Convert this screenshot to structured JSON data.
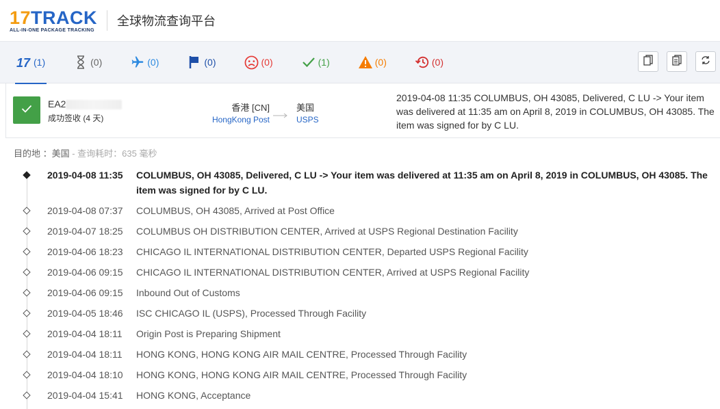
{
  "header": {
    "logo_17": "17",
    "logo_track": "TRACK",
    "logo_tagline": "ALL-IN-ONE PACKAGE TRACKING",
    "title": "全球物流查询平台"
  },
  "filters": [
    {
      "icon": "17track-logo-icon",
      "count": "(1)",
      "color": "#2565c6"
    },
    {
      "icon": "hourglass-icon",
      "count": "(0)",
      "color": "#666666"
    },
    {
      "icon": "airplane-icon",
      "count": "(0)",
      "color": "#2d8ae0"
    },
    {
      "icon": "flag-icon",
      "count": "(0)",
      "color": "#1e4fa8"
    },
    {
      "icon": "sad-face-icon",
      "count": "(0)",
      "color": "#e53935"
    },
    {
      "icon": "checkmark-icon",
      "count": "(1)",
      "color": "#43a047"
    },
    {
      "icon": "warning-icon",
      "count": "(0)",
      "color": "#f57c00"
    },
    {
      "icon": "history-icon",
      "count": "(0)",
      "color": "#d32f2f"
    }
  ],
  "toolbar_buttons": [
    "copy-icon",
    "copy-all-icon",
    "refresh-icon"
  ],
  "summary": {
    "tracking_prefix": "EA2",
    "status": "成功签收 (4 天)",
    "origin_country": "香港 [CN]",
    "origin_carrier": "HongKong Post",
    "dest_country": "美国",
    "dest_carrier": "USPS",
    "latest_event": "2019-04-08 11:35   COLUMBUS, OH 43085, Delivered, C LU -> Your item was delivered at 11:35 am on April 8, 2019 in COLUMBUS, OH 43085. The item was signed for by C LU."
  },
  "destination_line": {
    "label": "目的地 ：美国",
    "query_time": " - 查询耗时：635 毫秒"
  },
  "events": [
    {
      "time": "2019-04-08 11:35",
      "desc": "COLUMBUS, OH 43085, Delivered, C LU -> Your item was delivered at 11:35 am on April 8, 2019 in COLUMBUS, OH 43085. The item was signed for by C LU."
    },
    {
      "time": "2019-04-08 07:37",
      "desc": "COLUMBUS, OH 43085, Arrived at Post Office"
    },
    {
      "time": "2019-04-07 18:25",
      "desc": "COLUMBUS OH DISTRIBUTION CENTER, Arrived at USPS Regional Destination Facility"
    },
    {
      "time": "2019-04-06 18:23",
      "desc": "CHICAGO IL INTERNATIONAL DISTRIBUTION CENTER, Departed USPS Regional Facility"
    },
    {
      "time": "2019-04-06 09:15",
      "desc": "CHICAGO IL INTERNATIONAL DISTRIBUTION CENTER, Arrived at USPS Regional Facility"
    },
    {
      "time": "2019-04-06 09:15",
      "desc": "Inbound Out of Customs"
    },
    {
      "time": "2019-04-05 18:46",
      "desc": "ISC CHICAGO IL (USPS), Processed Through Facility"
    },
    {
      "time": "2019-04-04 18:11",
      "desc": "Origin Post is Preparing Shipment"
    },
    {
      "time": "2019-04-04 18:11",
      "desc": "HONG KONG, HONG KONG AIR MAIL CENTRE, Processed Through Facility"
    },
    {
      "time": "2019-04-04 18:10",
      "desc": "HONG KONG, HONG KONG AIR MAIL CENTRE, Processed Through Facility"
    },
    {
      "time": "2019-04-04 15:41",
      "desc": "HONG KONG, Acceptance"
    }
  ]
}
